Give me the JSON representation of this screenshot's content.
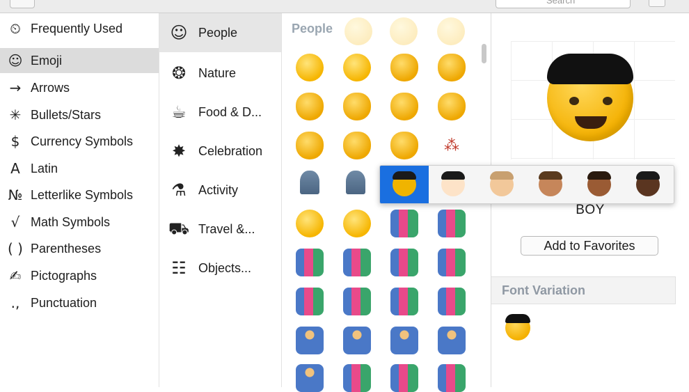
{
  "categories": [
    {
      "icon": "clock-icon",
      "glyph": "⏲",
      "label": "Frequently Used"
    },
    {
      "icon": "smiley-icon",
      "glyph": "☺",
      "label": "Emoji",
      "selected": true
    },
    {
      "icon": "arrow-icon",
      "glyph": "→",
      "label": "Arrows"
    },
    {
      "icon": "asterisk-icon",
      "glyph": "✳",
      "label": "Bullets/Stars"
    },
    {
      "icon": "dollar-icon",
      "glyph": "$",
      "label": "Currency Symbols"
    },
    {
      "icon": "latin-a-icon",
      "glyph": "A",
      "label": "Latin"
    },
    {
      "icon": "numero-icon",
      "glyph": "№",
      "label": "Letterlike Symbols"
    },
    {
      "icon": "sqrt-icon",
      "glyph": "√",
      "label": "Math Symbols"
    },
    {
      "icon": "parentheses-icon",
      "glyph": "( )",
      "label": "Parentheses"
    },
    {
      "icon": "pencil-icon",
      "glyph": "✍",
      "label": "Pictographs"
    },
    {
      "icon": "punctuation-icon",
      "glyph": ".,",
      "label": "Punctuation"
    }
  ],
  "groups": [
    {
      "icon": "smiley-icon",
      "glyph": "☺",
      "label": "People",
      "selected": true
    },
    {
      "icon": "tree-icon",
      "glyph": "❂",
      "label": "Nature"
    },
    {
      "icon": "cake-icon",
      "glyph": "☕",
      "label": "Food & D..."
    },
    {
      "icon": "confetti-icon",
      "glyph": "✸",
      "label": "Celebration"
    },
    {
      "icon": "runner-icon",
      "glyph": "⚗",
      "label": "Activity"
    },
    {
      "icon": "car-icon",
      "glyph": "⛟",
      "label": "Travel &..."
    },
    {
      "icon": "objects-icon",
      "glyph": "☷",
      "label": "Objects..."
    }
  ],
  "grid": {
    "header": "People"
  },
  "detail": {
    "name": "BOY",
    "favorites_button": "Add to Favorites",
    "font_variation_title": "Font Variation"
  },
  "skin_tones": {
    "selected_index": 0,
    "tones": [
      "#f0b400",
      "#fde3c8",
      "#f2c89a",
      "#c6865a",
      "#9a5b34",
      "#5a3520"
    ]
  },
  "toolbar": {
    "search_placeholder": "Search"
  }
}
